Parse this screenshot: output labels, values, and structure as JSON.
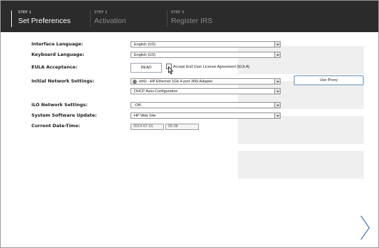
{
  "steps": [
    {
      "num": "STEP 1",
      "name": "Set Preferences"
    },
    {
      "num": "STEP 2",
      "name": "Activation"
    },
    {
      "num": "STEP 3",
      "name": "Register IRS"
    }
  ],
  "form": {
    "interface_language": {
      "label": "Interface Language:",
      "value": "English (US)"
    },
    "keyboard_language": {
      "label": "Keyboard Language:",
      "value": "English (US)"
    },
    "eula": {
      "label": "EULA Acceptance:",
      "read_label": "READ",
      "checkbox_label": "Accept End User License Agreement (EULA)"
    },
    "network": {
      "label": "Initial Network Settings:",
      "adapter": "eth0 - HP Ethernet 1Gb 4-port 366i Adapter",
      "mode": "DHCP Auto-Configuration",
      "proxy_label": "Use Proxy"
    },
    "ilo": {
      "label": "iLO Network Settings:",
      "value": "-Off-"
    },
    "software_update": {
      "label": "System Software Update:",
      "value": "HP Web Site"
    },
    "datetime": {
      "label": "Current Date-Time:",
      "date": "2014-07-16",
      "time": "05:38"
    }
  },
  "icons": {
    "next": "chevron-right-icon",
    "cursor": "mouse-pointer-icon",
    "adapter": "network-globe-icon"
  },
  "colors": {
    "header_bg": "#2b2b2b",
    "accent": "#5f8fbf"
  }
}
